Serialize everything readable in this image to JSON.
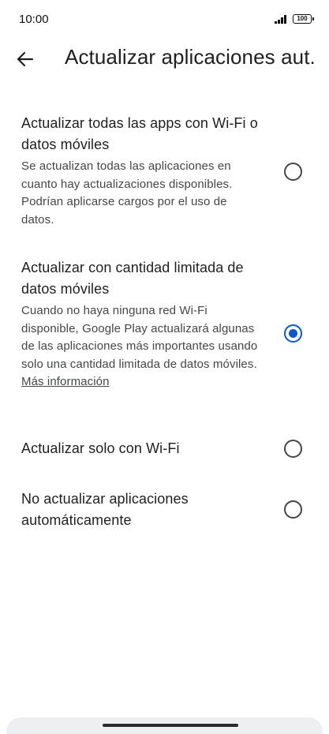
{
  "status_bar": {
    "time": "10:00",
    "battery": "100"
  },
  "app_bar": {
    "back_icon": "arrow-back-icon",
    "title": "Actualizar aplicaciones aut..."
  },
  "options": [
    {
      "title": "Actualizar todas las apps con Wi-Fi o datos móviles",
      "description": "Se actualizan todas las aplicaciones en cuanto hay actualizaciones disponibles. Podrían aplicarse cargos por el uso de datos.",
      "selected": false
    },
    {
      "title": "Actualizar con cantidad limitada de datos móviles",
      "description": "Cuando no haya ninguna red Wi-Fi disponible, Google Play actualizará algunas de las aplicaciones más importantes usando solo una cantidad limitada de datos móviles.",
      "link": "Más información",
      "selected": true
    },
    {
      "title": "Actualizar solo con Wi-Fi",
      "selected": false
    },
    {
      "title": "No actualizar aplicaciones automáticamente",
      "selected": false
    }
  ],
  "colors": {
    "accent": "#0b57d0",
    "text_primary": "#1f1f1f",
    "text_secondary": "#444746"
  }
}
